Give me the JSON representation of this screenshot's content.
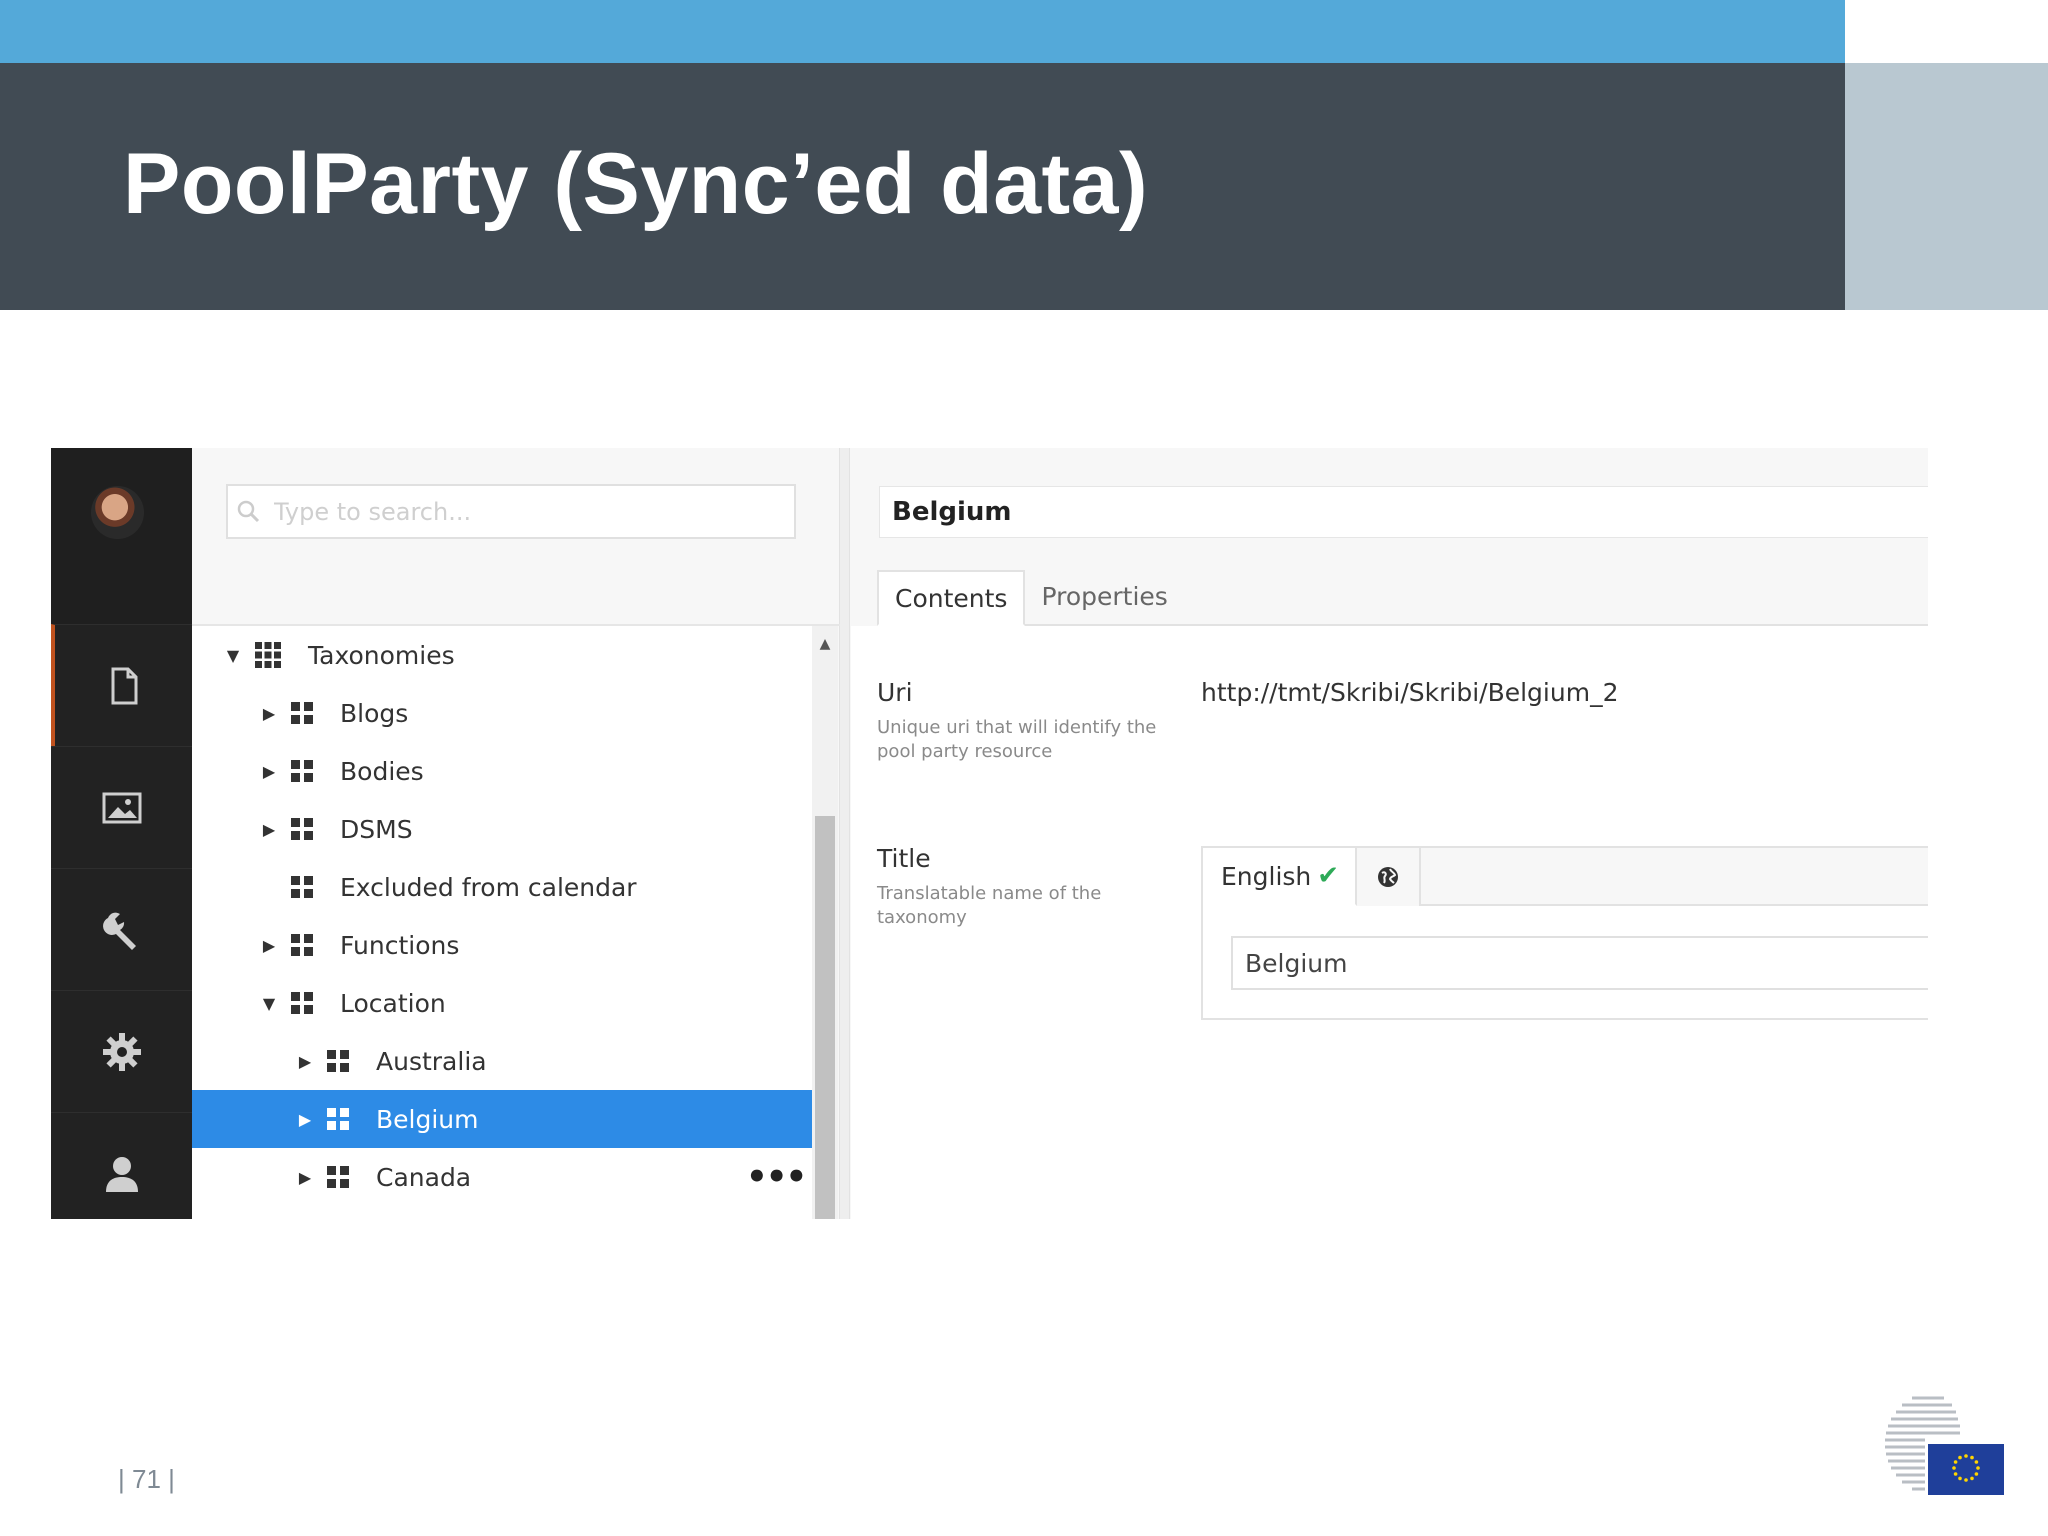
{
  "slide": {
    "title": "PoolParty  (Sync’ed data)",
    "page_number": "| 71 |"
  },
  "colors": {
    "top_strip": "#54a9d9",
    "header_band": "#414b54",
    "header_side": "#b9c8d1",
    "selection": "#2d8be6",
    "rail": "#222222",
    "check": "#2eaa58"
  },
  "rail": {
    "icons": [
      "avatar",
      "document-icon",
      "image-icon",
      "wrench-icon",
      "gear-icon",
      "user-icon"
    ],
    "active": "document-icon"
  },
  "search": {
    "placeholder": "Type to search..."
  },
  "tree": {
    "items": [
      {
        "label": "Taxonomies",
        "level": 0,
        "expanded": true,
        "has_children": true
      },
      {
        "label": "Blogs",
        "level": 1,
        "expanded": false,
        "has_children": true
      },
      {
        "label": "Bodies",
        "level": 1,
        "expanded": false,
        "has_children": true
      },
      {
        "label": "DSMS",
        "level": 1,
        "expanded": false,
        "has_children": true
      },
      {
        "label": "Excluded from calendar",
        "level": 1,
        "expanded": false,
        "has_children": false
      },
      {
        "label": "Functions",
        "level": 1,
        "expanded": false,
        "has_children": true
      },
      {
        "label": "Location",
        "level": 1,
        "expanded": true,
        "has_children": true
      },
      {
        "label": "Australia",
        "level": 2,
        "expanded": false,
        "has_children": true
      },
      {
        "label": "Belgium",
        "level": 2,
        "expanded": false,
        "has_children": true,
        "selected": true
      },
      {
        "label": "Canada",
        "level": 2,
        "expanded": false,
        "has_children": true,
        "more": "•••"
      }
    ]
  },
  "detail": {
    "name": "Belgium",
    "tabs": [
      {
        "label": "Contents",
        "active": true
      },
      {
        "label": "Properties",
        "active": false
      }
    ],
    "uri": {
      "label": "Uri",
      "help": "Unique uri that will identify the pool party resource",
      "value": "http://tmt/Skribi/Skribi/Belgium_2"
    },
    "title": {
      "label": "Title",
      "help": "Translatable name of the taxonomy",
      "language": "English",
      "language_status_icon": "check-icon",
      "globe_icon": "globe-icon",
      "value": "Belgium"
    }
  }
}
